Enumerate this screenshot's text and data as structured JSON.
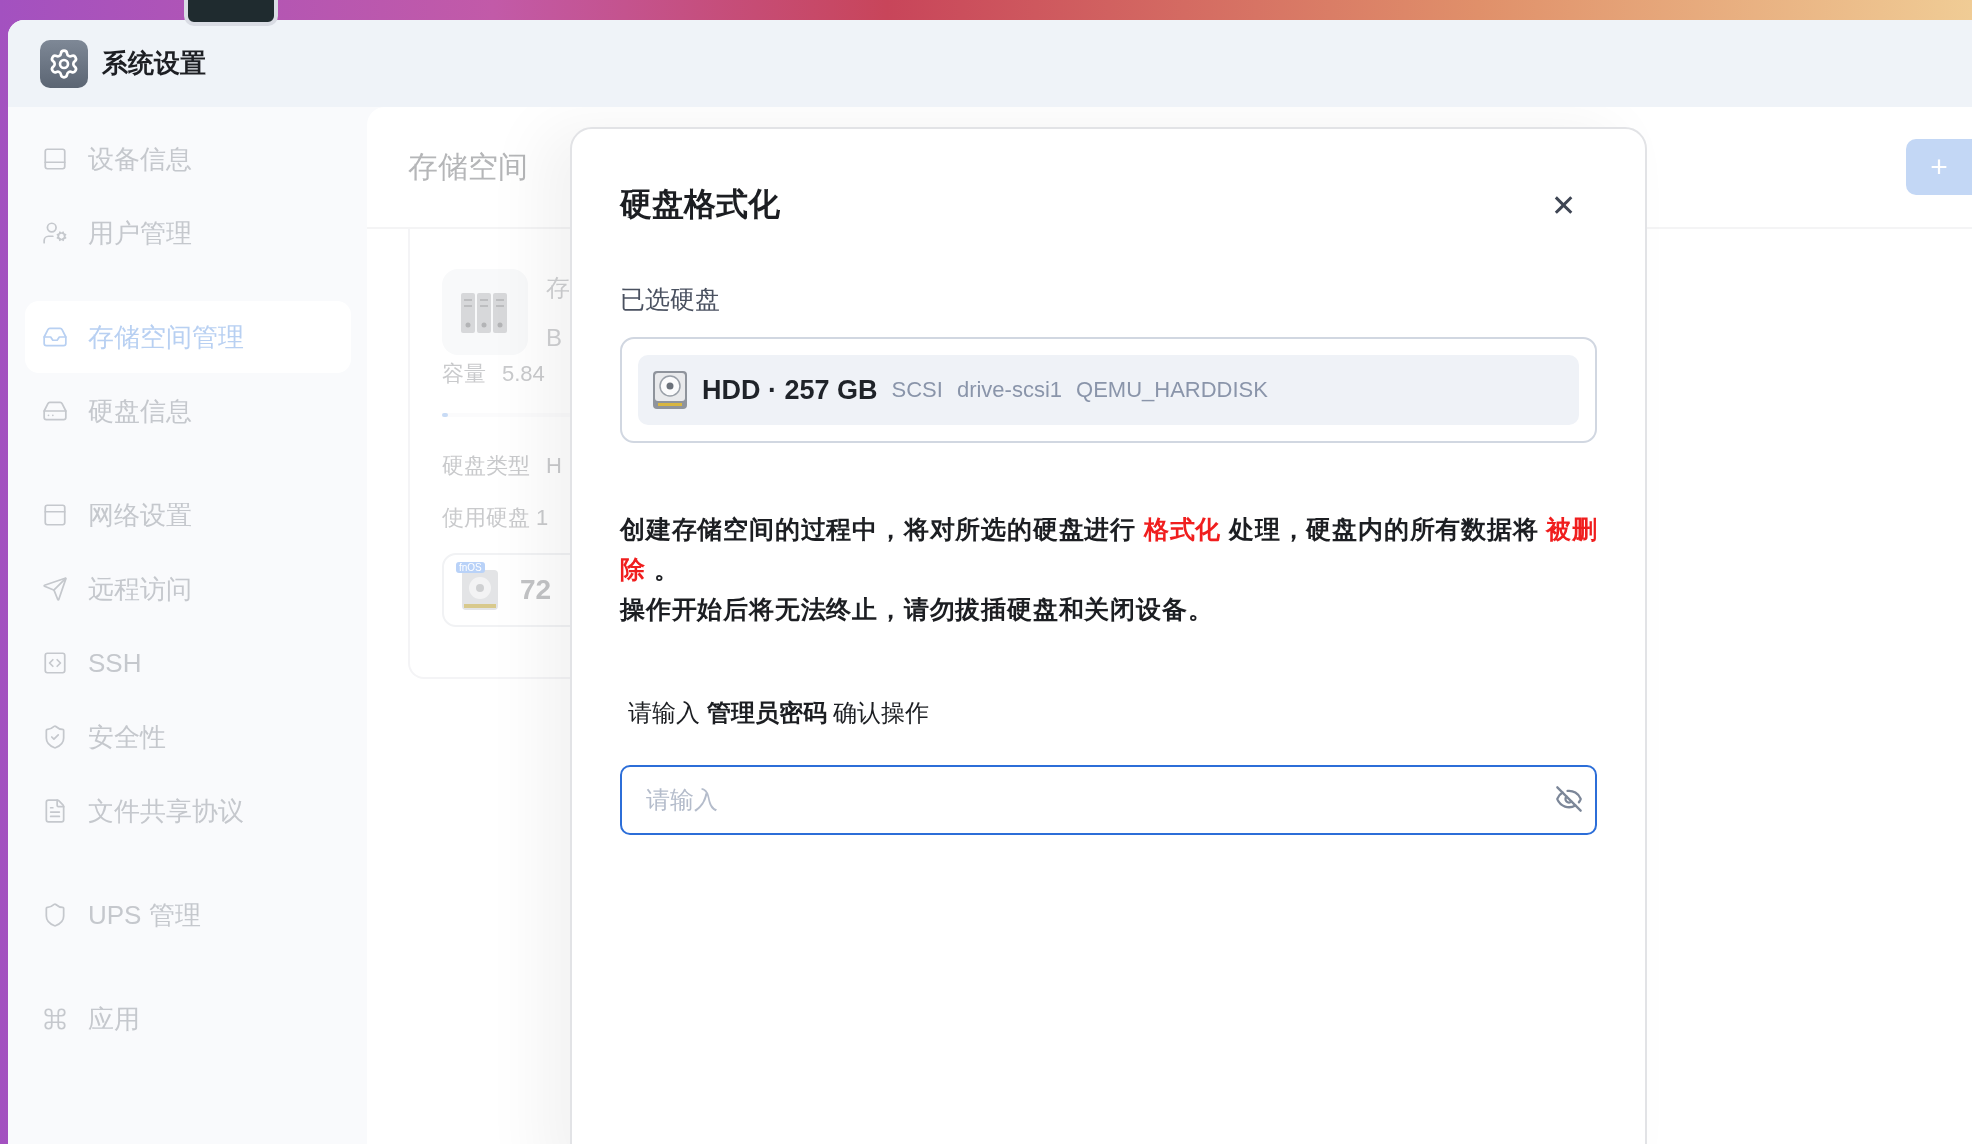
{
  "window": {
    "title": "系统设置"
  },
  "sidebar": {
    "groups": [
      {
        "items": [
          {
            "label": "设备信息",
            "selected": false
          },
          {
            "label": "用户管理",
            "selected": false
          }
        ]
      },
      {
        "items": [
          {
            "label": "存储空间管理",
            "selected": true
          },
          {
            "label": "硬盘信息",
            "selected": false
          }
        ]
      },
      {
        "items": [
          {
            "label": "网络设置",
            "selected": false
          },
          {
            "label": "远程访问",
            "selected": false
          },
          {
            "label": "SSH",
            "selected": false
          },
          {
            "label": "安全性",
            "selected": false
          },
          {
            "label": "文件共享协议",
            "selected": false
          }
        ]
      },
      {
        "items": [
          {
            "label": "UPS 管理",
            "selected": false
          }
        ]
      },
      {
        "items": [
          {
            "label": "应用",
            "selected": false
          }
        ]
      }
    ]
  },
  "page": {
    "title": "存储空间",
    "add_button": "+",
    "card": {
      "name": "存",
      "subtitle": "B",
      "capacity_label": "容量",
      "capacity_value": "5.84",
      "usage": {
        "level": 0.01
      },
      "disk_type_label": "硬盘类型",
      "disk_type_value": "H",
      "disks_used": "使用硬盘 1",
      "disk_badge": "fnOS",
      "disk_size": "72"
    }
  },
  "dialog": {
    "title": "硬盘格式化",
    "close": "✕",
    "selected_label": "已选硬盘",
    "disk": {
      "type_size": "HDD · 257 GB",
      "tags": [
        "SCSI",
        "drive-scsi1",
        "QEMU_HARDDISK"
      ]
    },
    "warning": [
      [
        {
          "text": "创建存储空间的过程中，将对所选的硬盘进行 ",
          "kind": "plain"
        },
        {
          "text": "格式化",
          "kind": "danger"
        },
        {
          "text": " 处理，硬盘内的所有数据将 ",
          "kind": "plain"
        },
        {
          "text": "被删除",
          "kind": "danger"
        },
        {
          "text": " 。",
          "kind": "plain"
        }
      ],
      [
        {
          "text": "操作开始后将无法终止，请勿拔插硬盘和关闭设备。",
          "kind": "plain"
        }
      ]
    ],
    "password_label": "请输入 **管理员密码** 确认操作",
    "password": {
      "placeholder": "请输入",
      "visible": false
    }
  }
}
